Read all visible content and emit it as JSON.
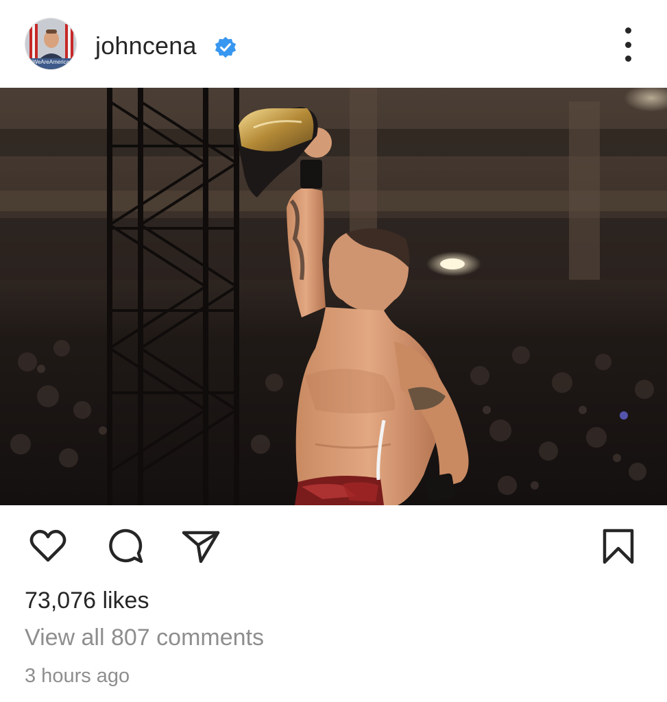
{
  "post": {
    "username": "johncena",
    "verified": true,
    "avatar_caption": "#WeAreAmerica",
    "likes_text": "73,076 likes",
    "comments_text": "View all 807 comments",
    "timestamp": "3 hours ago"
  },
  "colors": {
    "verified": "#3897f0",
    "text_primary": "#262626",
    "text_secondary": "#8e8e8e"
  },
  "icons": {
    "like": "heart-icon",
    "comment": "comment-bubble-icon",
    "share": "paper-plane-icon",
    "save": "bookmark-icon",
    "more": "more-options-icon",
    "verified": "verified-badge-icon"
  }
}
